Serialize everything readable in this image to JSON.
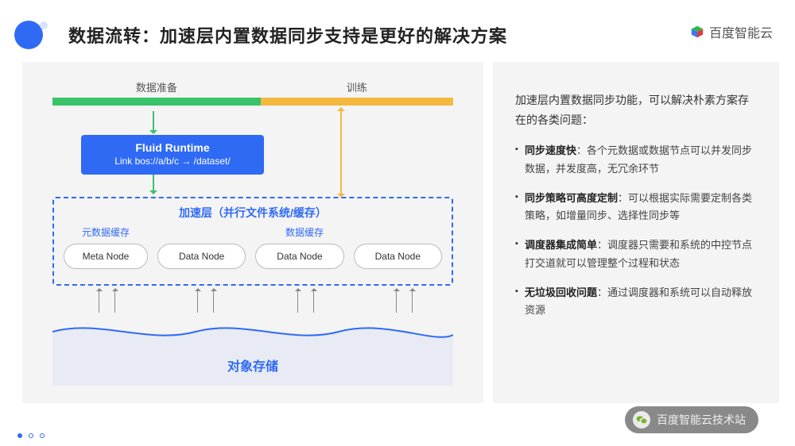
{
  "header": {
    "title": "数据流转：加速层内置数据同步支持是更好的解决方案",
    "brand": "百度智能云"
  },
  "stages": {
    "prep": "数据准备",
    "train": "训练"
  },
  "runtime": {
    "title": "Fluid Runtime",
    "sub": "Link bos://a/b/c → /dataset/"
  },
  "accel": {
    "title": "加速层（并行文件系统/缓存）",
    "metaCacheLabel": "元数据缓存",
    "dataCacheLabel": "数据缓存",
    "metaNode": "Meta Node",
    "dataNode1": "Data Node",
    "dataNode2": "Data Node",
    "dataNode3": "Data Node"
  },
  "storageLabel": "对象存储",
  "right": {
    "intro": "加速层内置数据同步功能，可以解决朴素方案存在的各类问题：",
    "items": [
      {
        "b": "同步速度快",
        "t": "：各个元数据或数据节点可以并发同步数据，并发度高，无冗余环节"
      },
      {
        "b": "同步策略可高度定制",
        "t": "：可以根据实际需要定制各类策略，如增量同步、选择性同步等"
      },
      {
        "b": "调度器集成简单",
        "t": "：调度器只需要和系统的中控节点打交道就可以管理整个过程和状态"
      },
      {
        "b": "无垃圾回收问题",
        "t": "：通过调度器和系统可以自动释放资源"
      }
    ]
  },
  "wxBadge": "百度智能云技术站",
  "colors": {
    "primary": "#2f6af5",
    "green": "#39c36b",
    "orange": "#f4b93f"
  }
}
